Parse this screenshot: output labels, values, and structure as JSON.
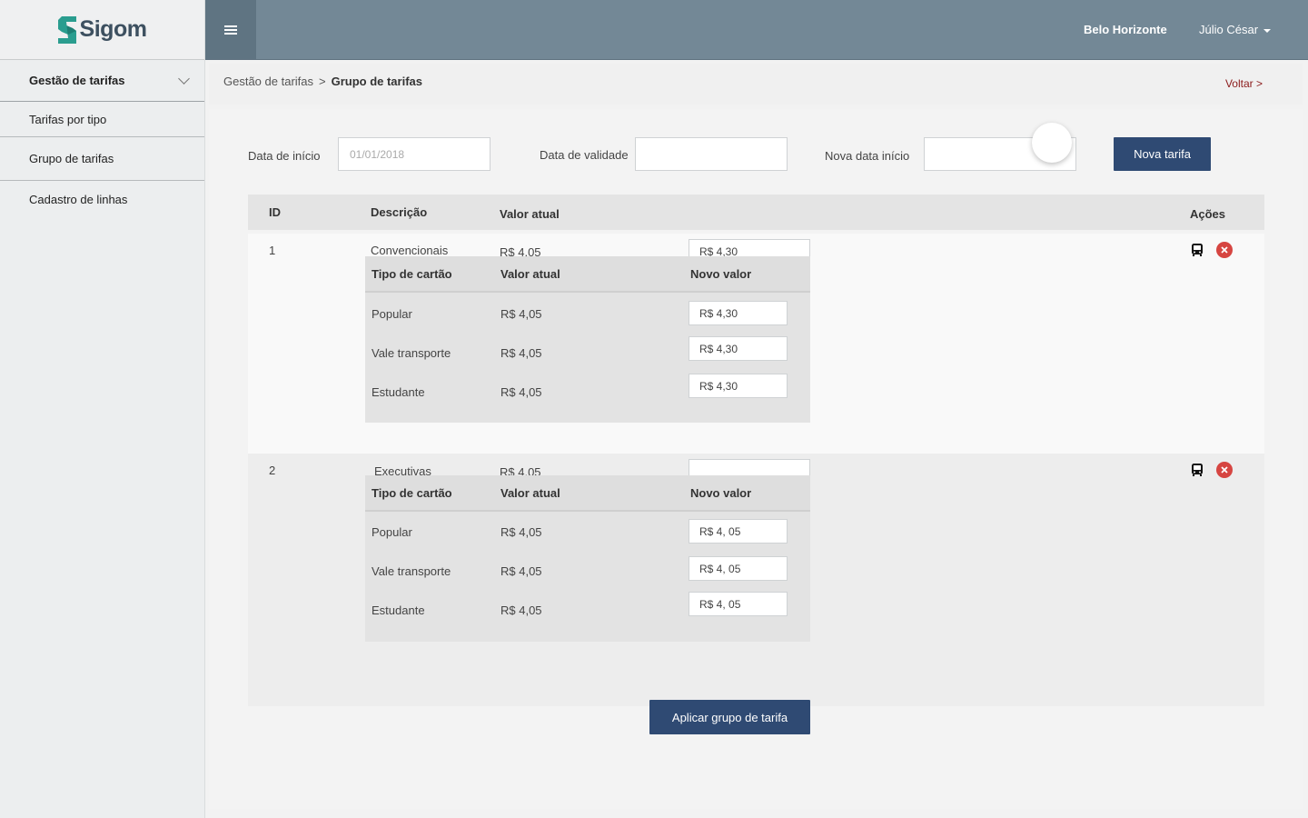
{
  "app": {
    "logo_text": "Sigom"
  },
  "topbar": {
    "city": "Belo Horizonte",
    "user": "Júlio César"
  },
  "sidebar": {
    "section": "Gestão de tarifas",
    "items": [
      {
        "label": "Tarifas por tipo"
      },
      {
        "label": "Grupo de tarifas"
      },
      {
        "label": "Cadastro de linhas"
      }
    ]
  },
  "breadcrumb": {
    "parent": "Gestão de tarifas",
    "separator": ">",
    "current": "Grupo de tarifas",
    "back": "Voltar >"
  },
  "filters": {
    "start_label": "Data de início",
    "start_placeholder": "01/01/2018",
    "validity_label": "Data de validade",
    "new_start_label": "Nova data início",
    "new_button": "Nova tarifa"
  },
  "table": {
    "headers": {
      "id": "ID",
      "description": "Descrição",
      "current_value": "Valor atual",
      "actions": "Ações"
    },
    "sub_headers": {
      "card_type": "Tipo de cartão",
      "current_value": "Valor atual",
      "new_value": "Novo valor"
    },
    "rows": [
      {
        "id": "1",
        "description": "Convencionais",
        "current_value": "R$ 4.05",
        "new_value": "R$ 4,30",
        "cards": [
          {
            "type": "Popular",
            "current": "R$ 4,05",
            "new": "R$ 4,30"
          },
          {
            "type": "Vale transporte",
            "current": "R$ 4,05",
            "new": "R$ 4,30"
          },
          {
            "type": "Estudante",
            "current": "R$ 4,05",
            "new": "R$ 4,30"
          }
        ]
      },
      {
        "id": "2",
        "description": "Executivas",
        "current_value": "R$ 4.05",
        "new_value": "",
        "cards": [
          {
            "type": "Popular",
            "current": "R$ 4,05",
            "new": "R$ 4, 05"
          },
          {
            "type": "Vale transporte",
            "current": "R$ 4,05",
            "new": "R$ 4, 05"
          },
          {
            "type": "Estudante",
            "current": "R$ 4,05",
            "new": "R$ 4, 05"
          }
        ]
      }
    ]
  },
  "apply_button": "Aplicar  grupo de tarifa",
  "colors": {
    "topbar": "#738896",
    "primary_button": "#2f4a73",
    "back_link": "#8b1b1b",
    "delete": "#d64541",
    "logo_accent": "#2a9d8f"
  }
}
